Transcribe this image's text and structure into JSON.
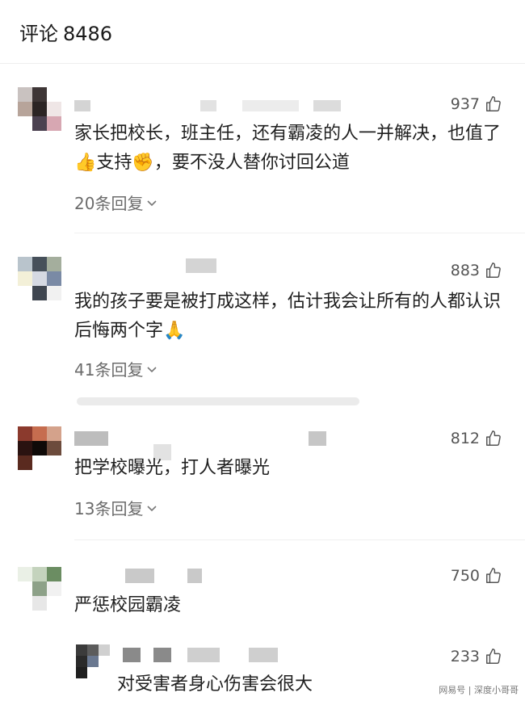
{
  "header": {
    "title": "评论",
    "count": "8486"
  },
  "comments": [
    {
      "likes": "937",
      "text_a": "家长把校长，班主任，还有霸凌的人一并解决，也值了",
      "emoji_a": "👍",
      "text_b": "支持",
      "emoji_b": "✊",
      "text_c": "，要不没人替你讨回公道",
      "replies": "20条回复"
    },
    {
      "likes": "883",
      "text_a": "我的孩子要是被打成这样，估计我会让所有的人都认识后悔两个字",
      "emoji_a": "🙏",
      "replies": "41条回复"
    },
    {
      "likes": "812",
      "text_a": "把学校曝光，打人者曝光",
      "replies": "13条回复"
    },
    {
      "likes": "750",
      "text_a": "严惩校园霸凌"
    },
    {
      "likes": "233",
      "text_a": "对受害者身心伤害会很大"
    }
  ],
  "watermark": "网易号 | 深度小哥哥",
  "icons": {
    "like": "thumbs-up-icon",
    "expand": "chevron-down-icon"
  }
}
